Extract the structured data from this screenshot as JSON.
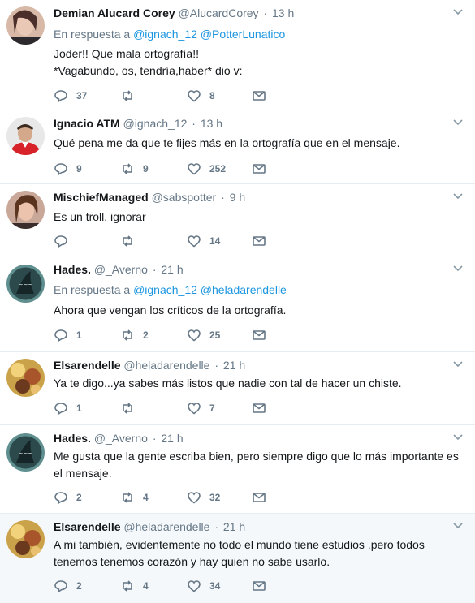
{
  "tweets": [
    {
      "name": "Demian Alucard Corey",
      "handle": "@AlucardCorey",
      "time": "13 h",
      "reply_prefix": "En respuesta a",
      "reply_to": [
        "@ignach_12",
        "@PotterLunatico"
      ],
      "text": "Joder!! Que mala ortografía!!\n*Vagabundo, os, tendría,haber* dio v:",
      "replies": "37",
      "retweets": "",
      "likes": "8"
    },
    {
      "name": "Ignacio ATM",
      "handle": "@ignach_12",
      "time": "13 h",
      "text": "Qué pena me da que te fijes más en la ortografía que en el mensaje.",
      "replies": "9",
      "retweets": "9",
      "likes": "252"
    },
    {
      "name": "MischiefManaged",
      "handle": "@sabspotter",
      "time": "9 h",
      "text": "Es un troll, ignorar",
      "replies": "",
      "retweets": "",
      "likes": "14"
    },
    {
      "name": "Hades.",
      "handle": "@_Averno",
      "time": "21 h",
      "reply_prefix": "En respuesta a",
      "reply_to": [
        "@ignach_12",
        "@heladarendelle"
      ],
      "text": "Ahora que vengan los críticos de la ortografía.",
      "replies": "1",
      "retweets": "2",
      "likes": "25"
    },
    {
      "name": "Elsarendelle",
      "handle": "@heladarendelle",
      "time": "21 h",
      "text": "Ya te digo...ya sabes más listos que nadie con tal de hacer un chiste.",
      "replies": "1",
      "retweets": "",
      "likes": "7"
    },
    {
      "name": "Hades.",
      "handle": "@_Averno",
      "time": "21 h",
      "text": "Me gusta que la gente escriba bien, pero siempre digo que lo más importante es\nel mensaje.",
      "replies": "2",
      "retweets": "4",
      "likes": "32"
    },
    {
      "name": "Elsarendelle",
      "handle": "@heladarendelle",
      "time": "21 h",
      "text": "A mi también, evidentemente no todo el mundo tiene estudios ,pero todos\ntenemos tenemos corazón y hay quien no sabe usarlo.",
      "replies": "2",
      "retweets": "4",
      "likes": "34"
    }
  ],
  "colors": {
    "link": "#1b95e0",
    "muted": "#657786",
    "thread_line": "#a7d3ef",
    "highlight_bg": "#f5f8fa"
  },
  "icons": {
    "reply": "reply-icon",
    "retweet": "retweet-icon",
    "like": "heart-icon",
    "dm": "envelope-icon",
    "menu": "chevron-down-icon"
  }
}
